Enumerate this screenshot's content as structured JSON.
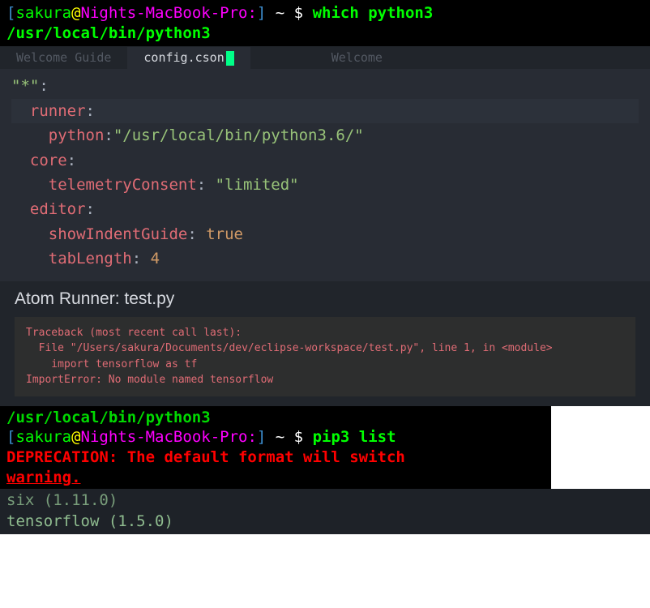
{
  "terminal1": {
    "prompt": {
      "lbracket": "[",
      "user": "sakura",
      "at": "@",
      "host": "Nights-MacBook-Pro:",
      "rbracket": "]",
      "tilde": " ~",
      "dollar": " $ ",
      "cmd": "which python3"
    },
    "output": "/usr/local/bin/python3"
  },
  "tabs": {
    "left": "Welcome Guide",
    "center": "config.cson",
    "right": "Welcome"
  },
  "config_code": {
    "l1_s": "\"*\"",
    "l1_p": ":",
    "l2_k": "  runner",
    "l2_p": ":",
    "l3_k": "    python",
    "l3_p": ":",
    "l3_s": "\"/usr/local/bin/python3.6/\"",
    "l4_k": "  core",
    "l4_p": ":",
    "l5_k": "    telemetryConsent",
    "l5_p": ": ",
    "l5_s": "\"limited\"",
    "l6_k": "  editor",
    "l6_p": ":",
    "l7_k": "    showIndentGuide",
    "l7_p": ": ",
    "l7_b": "true",
    "l8_k": "    tabLength",
    "l8_p": ": ",
    "l8_n": "4"
  },
  "runner": {
    "title": "Atom Runner: test.py",
    "trace_l1": "Traceback (most recent call last):",
    "trace_l2": "  File \"/Users/sakura/Documents/dev/eclipse-workspace/test.py\", line 1, in <module>",
    "trace_l3": "    import tensorflow as tf",
    "trace_l4": "ImportError: No module named tensorflow"
  },
  "terminal2": {
    "prevline": "/usr/local/bin/python3",
    "prompt": {
      "lbracket": "[",
      "user": "sakura",
      "at": "@",
      "host": "Nights-MacBook-Pro:",
      "rbracket": "]",
      "tilde": " ~",
      "dollar": " $ ",
      "cmd": "pip3 list"
    },
    "dep_l1": "DEPRECATION: The default format will switch",
    "dep_l2": "warning."
  },
  "pip_list": {
    "pkg1": "six (1.11.0)",
    "pkg2": "tensorflow (1.5.0)"
  }
}
